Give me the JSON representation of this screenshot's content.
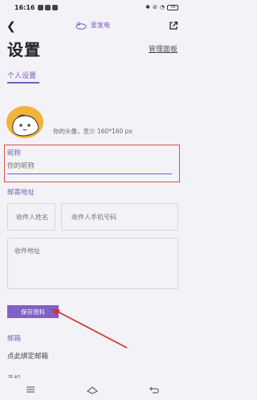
{
  "status_bar": {
    "time": "16:16",
    "battery": "76"
  },
  "header": {
    "app_name": "爱发电"
  },
  "page": {
    "title": "设置",
    "admin_link": "管理面板",
    "tab_personal": "个人设置"
  },
  "avatar": {
    "hint": "你的头像，至少 160*160 px"
  },
  "nickname": {
    "label": "昵称",
    "placeholder": "你的昵称"
  },
  "mail_address": {
    "label": "邮寄地址",
    "name_placeholder": "收件人姓名",
    "phone_placeholder": "收件人手机号码",
    "address_placeholder": "收件地址"
  },
  "save_button": {
    "label": "保存资料"
  },
  "email": {
    "label": "邮箱",
    "bind_text": "点此绑定邮箱"
  },
  "phone": {
    "label": "手机"
  },
  "colors": {
    "accent": "#7a5dc0",
    "button": "#8160c8",
    "highlight_box": "#d9534f",
    "annotation_arrow": "#d32f2f"
  }
}
